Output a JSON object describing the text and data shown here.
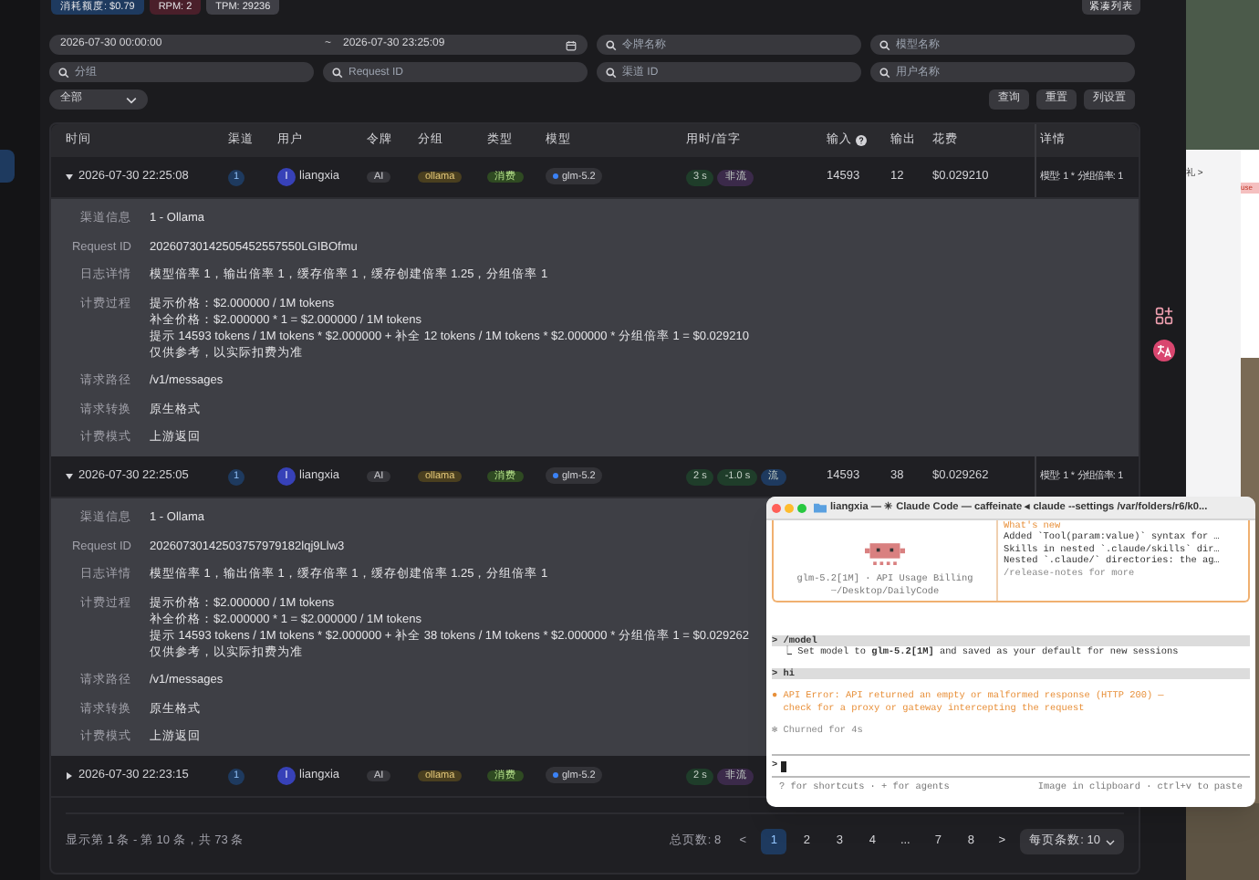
{
  "top_stats": [
    {
      "text": "消耗额度: $0.79",
      "color": "#1e3a5f"
    },
    {
      "text": "RPM: 2",
      "color": "#4a1f2a"
    },
    {
      "text": "TPM: 29236",
      "color": "#3f3f46"
    }
  ],
  "compact_button": "紧凑列表",
  "filters": {
    "date_start": "2026-07-30 00:00:00",
    "date_sep": "~",
    "date_end": "2026-07-30 23:25:09",
    "fields": [
      {
        "placeholder": "令牌名称"
      },
      {
        "placeholder": "模型名称"
      },
      {
        "placeholder": "分组"
      },
      {
        "placeholder": "Request ID"
      },
      {
        "placeholder": "渠道 ID"
      },
      {
        "placeholder": "用户名称"
      }
    ],
    "type_select": "全部",
    "buttons": [
      "查询",
      "重置",
      "列设置"
    ]
  },
  "table": {
    "columns": [
      {
        "label": "时间"
      },
      {
        "label": "渠道"
      },
      {
        "label": "用户"
      },
      {
        "label": "令牌"
      },
      {
        "label": "分组"
      },
      {
        "label": "类型"
      },
      {
        "label": "模型"
      },
      {
        "label": "用时/首字"
      },
      {
        "label": "输入",
        "help": true
      },
      {
        "label": "输出"
      },
      {
        "label": "花费"
      },
      {
        "label": "详情"
      }
    ],
    "rows": [
      {
        "expanded": true,
        "time": "2026-07-30 22:25:08",
        "channel": "1",
        "user_initial": "l",
        "user": "liangxia",
        "token": "AI",
        "group": "ollama",
        "type": "消费",
        "model": "glm-5.2",
        "timing": [
          {
            "text": "3 s",
            "color": "#1f3d2a"
          },
          {
            "text": "非流",
            "color": "#3b2a4a"
          }
        ],
        "input": "14593",
        "output": "12",
        "cost": "$0.029210",
        "detail": "模型: 1 * 分组倍率: 1",
        "info": [
          {
            "label": "渠道信息",
            "lines": [
              "1 - Ollama"
            ]
          },
          {
            "label": "Request ID",
            "lines": [
              "20260730142505452557550LGIBOfmu"
            ]
          },
          {
            "label": "日志详情",
            "lines": [
              "模型倍率 1，输出倍率 1，缓存倍率 1，缓存创建倍率 1.25，分组倍率 1"
            ]
          },
          {
            "label": "计费过程",
            "lines": [
              "提示价格：$2.000000 / 1M tokens",
              "补全价格：$2.000000 * 1 = $2.000000 / 1M tokens",
              "提示 14593 tokens / 1M tokens * $2.000000 + 补全 12 tokens / 1M tokens * $2.000000 * 分组倍率 1 = $0.029210",
              "仅供参考，以实际扣费为准"
            ]
          },
          {
            "label": "请求路径",
            "lines": [
              "/v1/messages"
            ]
          },
          {
            "label": "请求转换",
            "lines": [
              "原生格式"
            ]
          },
          {
            "label": "计费模式",
            "lines": [
              "上游返回"
            ]
          }
        ]
      },
      {
        "expanded": true,
        "time": "2026-07-30 22:25:05",
        "channel": "1",
        "user_initial": "l",
        "user": "liangxia",
        "token": "AI",
        "group": "ollama",
        "type": "消费",
        "model": "glm-5.2",
        "timing": [
          {
            "text": "2 s",
            "color": "#1f3d2a"
          },
          {
            "text": "-1.0 s",
            "color": "#1f3d2a"
          },
          {
            "text": "流",
            "color": "#1e3a5f"
          }
        ],
        "input": "14593",
        "output": "38",
        "cost": "$0.029262",
        "detail": "模型: 1 * 分组倍率: 1",
        "info": [
          {
            "label": "渠道信息",
            "lines": [
              "1 - Ollama"
            ]
          },
          {
            "label": "Request ID",
            "lines": [
              "20260730142503757979182lqj9Llw3"
            ]
          },
          {
            "label": "日志详情",
            "lines": [
              "模型倍率 1，输出倍率 1，缓存倍率 1，缓存创建倍率 1.25，分组倍率 1"
            ]
          },
          {
            "label": "计费过程",
            "lines": [
              "提示价格：$2.000000 / 1M tokens",
              "补全价格：$2.000000 * 1 = $2.000000 / 1M tokens",
              "提示 14593 tokens / 1M tokens * $2.000000 + 补全 38 tokens / 1M tokens * $2.000000 * 分组倍率 1 = $0.029262",
              "仅供参考，以实际扣费为准"
            ]
          },
          {
            "label": "请求路径",
            "lines": [
              "/v1/messages"
            ]
          },
          {
            "label": "请求转换",
            "lines": [
              "原生格式"
            ]
          },
          {
            "label": "计费模式",
            "lines": [
              "上游返回"
            ]
          }
        ]
      },
      {
        "expanded": false,
        "time": "2026-07-30 22:23:15",
        "channel": "1",
        "user_initial": "l",
        "user": "liangxia",
        "token": "AI",
        "group": "ollama",
        "type": "消费",
        "model": "glm-5.2",
        "timing": [
          {
            "text": "2 s",
            "color": "#1f3d2a"
          },
          {
            "text": "非流",
            "color": "#3b2a4a"
          }
        ]
      }
    ]
  },
  "footer": {
    "summary": "显示第 1 条 - 第 10 条，共 73 条",
    "total_pages": "总页数: 8",
    "prev": "<",
    "next": ">",
    "pages": [
      {
        "label": "1",
        "selected": true
      },
      {
        "label": "2",
        "selected": false
      },
      {
        "label": "3",
        "selected": false
      },
      {
        "label": "4",
        "selected": false
      },
      {
        "label": "...",
        "selected": false
      },
      {
        "label": "7",
        "selected": false
      },
      {
        "label": "8",
        "selected": false
      }
    ],
    "page_size": "每页条数: 10"
  },
  "side_panel": {
    "texts": [
      "礼 >",
      "use"
    ]
  },
  "terminal": {
    "title": "liangxia — ✳ Claude Code — caffeinate ◂ claude --settings /var/folders/r6/k0...",
    "model_line": "glm-5.2[1M] · API Usage Billing",
    "cwd": "~/Desktop/DailyCode",
    "whats_new_title": "What's new",
    "whats_new": [
      "Added `Tool(param:value)` syntax for …",
      "Skills in nested `.claude/skills` dir…",
      "Nested `.claude/` directories: the ag…"
    ],
    "release_notes": "/release-notes for more",
    "history": [
      {
        "kind": "command",
        "text": "> /model"
      },
      {
        "kind": "output",
        "text": "⎿  Set model to **glm-5.2[1M]** and saved as your default for new sessions"
      },
      {
        "kind": "command",
        "text": "> hi"
      },
      {
        "kind": "error",
        "lines": [
          "● API Error: API returned an empty or malformed response (HTTP 200) —",
          "  check for a proxy or gateway intercepting the request"
        ]
      },
      {
        "kind": "status",
        "text": "✻ Churned for 4s"
      }
    ],
    "prompt": ">",
    "hint_left": "? for shortcuts · + for agents",
    "hint_right": "Image in clipboard · ctrl+v to paste"
  }
}
